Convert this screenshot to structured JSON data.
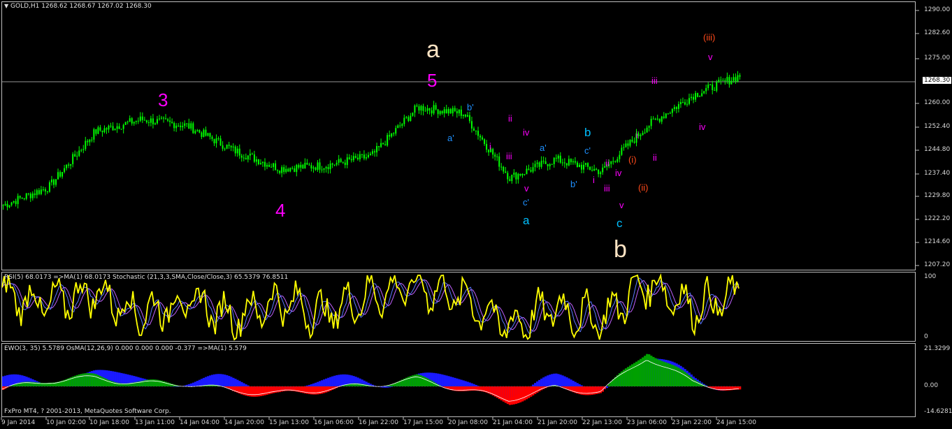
{
  "main_header": {
    "arrow": "▼",
    "symbol": "GOLD,H1",
    "ohlc": "1268.62 1268.67 1267.02 1268.30"
  },
  "current_price_label": "1268.30",
  "price_axis": [
    "1290.00",
    "1282.60",
    "1275.00",
    "1260.00",
    "1252.40",
    "1244.80",
    "1237.40",
    "1229.80",
    "1222.20",
    "1214.60",
    "1207.20"
  ],
  "rsi_header": "RSI(5) 68.0173   =>MA(1) 68.0173   Stochastic (21,3,3,SMA,Close/Close,3) 65.5379 76.8511",
  "rsi_axis": [
    "100",
    "0"
  ],
  "ewo_header": "EWO(3, 35) 5.5789   OsMA(12,26,9) 0.000 0.000 0.000 -0.377   =>MA(1) 5.579",
  "ewo_axis": [
    "21.3299",
    "0.00",
    "-14.6281"
  ],
  "copyright": "FxPro MT4, ? 2001-2013, MetaQuotes Software Corp.",
  "time_axis": [
    "9 Jan 2014",
    "10 Jan 02:00",
    "10 Jan 18:00",
    "13 Jan 11:00",
    "14 Jan 04:00",
    "14 Jan 20:00",
    "15 Jan 13:00",
    "16 Jan 06:00",
    "16 Jan 22:00",
    "17 Jan 15:00",
    "20 Jan 08:00",
    "21 Jan 04:00",
    "21 Jan 20:00",
    "22 Jan 13:00",
    "23 Jan 06:00",
    "23 Jan 22:00",
    "24 Jan 15:00"
  ],
  "wave_labels": [
    {
      "text": "a",
      "color": "#ffe4c4",
      "size": "big"
    },
    {
      "text": "5",
      "color": "#ff00ff",
      "size": "mid"
    },
    {
      "text": "3",
      "color": "#ff00ff",
      "size": "mid"
    },
    {
      "text": "4",
      "color": "#ff00ff",
      "size": "mid"
    },
    {
      "text": "b",
      "color": "#ffe4c4",
      "size": "big"
    },
    {
      "text": "(iii)",
      "color": "#ff4a1a",
      "size": "sm"
    },
    {
      "text": "v",
      "color": "#ff00ff",
      "size": "sm"
    },
    {
      "text": "iii",
      "color": "#ff00ff",
      "size": "sm"
    },
    {
      "text": "iv",
      "color": "#ff00ff",
      "size": "sm"
    },
    {
      "text": "i",
      "color": "#ff00ff",
      "size": "sm"
    },
    {
      "text": "ii",
      "color": "#ff00ff",
      "size": "sm"
    },
    {
      "text": "(i)",
      "color": "#ff4a1a",
      "size": "sm"
    },
    {
      "text": "(ii)",
      "color": "#ff4a1a",
      "size": "sm"
    },
    {
      "text": "b'",
      "color": "#1e90ff",
      "size": "sm"
    },
    {
      "text": "a'",
      "color": "#1e90ff",
      "size": "sm"
    },
    {
      "text": "ii",
      "color": "#ff00ff",
      "size": "sm"
    },
    {
      "text": "iv",
      "color": "#ff00ff",
      "size": "sm"
    },
    {
      "text": "i",
      "color": "#ff00ff",
      "size": "sm"
    },
    {
      "text": "iii",
      "color": "#ff00ff",
      "size": "sm"
    },
    {
      "text": "v",
      "color": "#ff00ff",
      "size": "sm"
    },
    {
      "text": "c'",
      "color": "#1e90ff",
      "size": "sm"
    },
    {
      "text": "a",
      "color": "#00bfff",
      "size": "smb"
    },
    {
      "text": "a'",
      "color": "#1e90ff",
      "size": "sm"
    },
    {
      "text": "b'",
      "color": "#1e90ff",
      "size": "sm"
    },
    {
      "text": "b",
      "color": "#00bfff",
      "size": "smb"
    },
    {
      "text": "c'",
      "color": "#1e90ff",
      "size": "sm"
    },
    {
      "text": "ii",
      "color": "#ff00ff",
      "size": "sm"
    },
    {
      "text": "i",
      "color": "#ff00ff",
      "size": "sm"
    },
    {
      "text": "iii",
      "color": "#ff00ff",
      "size": "sm"
    },
    {
      "text": "iv",
      "color": "#ff00ff",
      "size": "sm"
    },
    {
      "text": "v",
      "color": "#ff00ff",
      "size": "sm"
    },
    {
      "text": "c",
      "color": "#00bfff",
      "size": "smb"
    },
    {
      "text": "i",
      "color": "#ff00ff",
      "size": "sm"
    },
    {
      "text": "ii",
      "color": "#ff00ff",
      "size": "sm"
    },
    {
      "text": "iii",
      "color": "#ff00ff",
      "size": "sm"
    },
    {
      "text": "iv",
      "color": "#ff00ff",
      "size": "sm"
    }
  ],
  "chart_data": [
    {
      "type": "line",
      "title": "GOLD,H1",
      "description_series": "close",
      "x": [
        "9 Jan",
        "10 Jan 02:00",
        "10 Jan 18:00",
        "13 Jan 11:00",
        "14 Jan 04:00",
        "14 Jan 20:00",
        "15 Jan 13:00",
        "16 Jan 06:00",
        "16 Jan 22:00",
        "17 Jan 15:00",
        "20 Jan 08:00",
        "21 Jan 04:00",
        "21 Jan 20:00",
        "22 Jan 13:00",
        "23 Jan 06:00",
        "23 Jan 22:00",
        "24 Jan 15:00"
      ],
      "series": [
        {
          "values": [
            1226,
            1232,
            1250,
            1254,
            1252,
            1244,
            1238,
            1239,
            1242,
            1258,
            1256,
            1235,
            1241,
            1237,
            1252,
            1262,
            1268.3
          ]
        }
      ],
      "ylim": [
        1207.2,
        1292
      ]
    },
    {
      "type": "line",
      "series": [
        {
          "values": [
            70,
            55,
            75,
            40,
            60,
            35,
            60,
            40,
            70,
            85,
            65,
            20,
            50,
            30,
            90,
            50,
            68
          ]
        }
      ],
      "ylim": [
        0,
        100
      ]
    },
    {
      "type": "bar",
      "series": [
        {
          "values": [
            -2,
            4,
            6,
            2,
            2,
            -3,
            -5,
            -2,
            1,
            5,
            -2,
            -9,
            -1,
            -4,
            21,
            3,
            -3
          ]
        }
      ],
      "ylim": [
        -14.6281,
        21.3299
      ]
    }
  ],
  "colors": {
    "candles": "#00ff00",
    "grid_border": "#bfbfbf",
    "rsi": "#ffff00",
    "stoch_main": "#5a78ff",
    "stoch_signal": "#c060ff",
    "ewo_pos": "#00a000",
    "ewo_neg": "#ff0000",
    "osma": "#1a1aff"
  }
}
